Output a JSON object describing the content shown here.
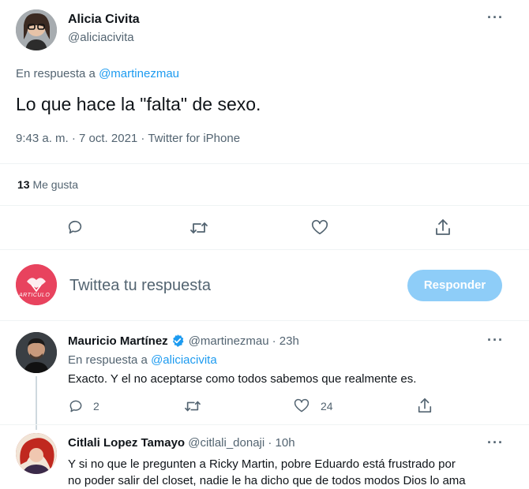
{
  "main_tweet": {
    "author_name": "Alicia Civita",
    "author_handle": "@aliciacivita",
    "reply_prefix": "En respuesta a",
    "reply_to": "@martinezmau",
    "text": "Lo que hace la \"falta\" de sexo.",
    "meta": "9:43 a. m. · 7 oct. 2021 · Twitter for iPhone",
    "likes_count": "13",
    "likes_label": "Me gusta",
    "more_icon": "more-dots-icon"
  },
  "compose": {
    "avatar_text": "ARTICULO",
    "placeholder": "Twittea tu respuesta",
    "button_label": "Responder",
    "button_color": "#8ecdf8"
  },
  "replies": [
    {
      "author_name": "Mauricio Martínez",
      "verified": true,
      "author_handle": "@martinezmau",
      "time": "· 23h",
      "reply_prefix": "En respuesta a",
      "reply_to": "@aliciacivita",
      "text": "Exacto. Y el no aceptarse como todos sabemos que realmente es.",
      "reply_count": "2",
      "like_count": "24"
    },
    {
      "author_name": "Citlali Lopez Tamayo",
      "author_handle": "@citlali_donaji",
      "time": "· 10h",
      "text_line1": "Y si no que le pregunten a Ricky Martin, pobre Eduardo está frustrado por",
      "text_line2": "no poder salir del closet, nadie le ha dicho que de todos modos Dios lo ama"
    }
  ],
  "colors": {
    "accent": "#1d9bf0",
    "muted": "#536471",
    "border": "#eff3f4"
  }
}
